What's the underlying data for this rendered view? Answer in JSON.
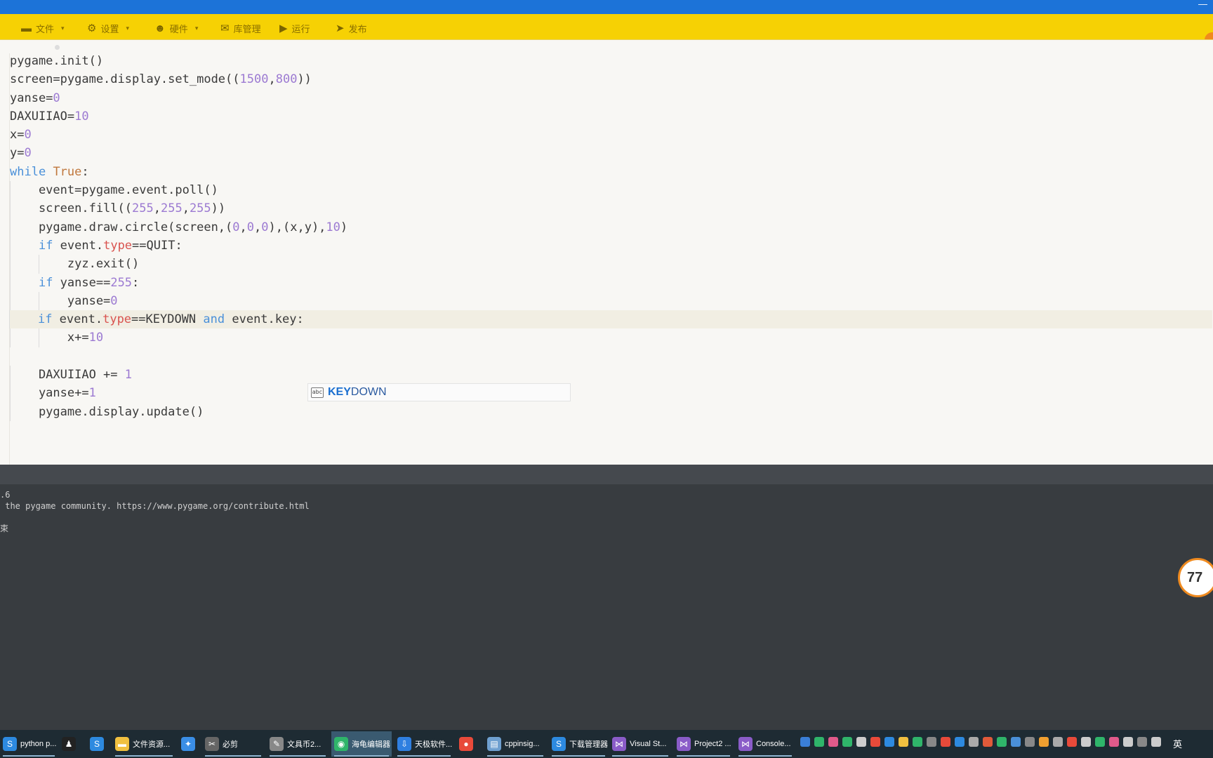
{
  "menu": [
    {
      "label": "文件",
      "icon": "folder-icon",
      "caret": true
    },
    {
      "label": "设置",
      "icon": "gear-icon",
      "caret": true
    },
    {
      "label": "硬件",
      "icon": "robot-icon",
      "caret": true
    },
    {
      "label": "库管理",
      "icon": "mail-icon",
      "caret": false
    },
    {
      "label": "运行",
      "icon": "play-icon",
      "caret": false
    },
    {
      "label": "发布",
      "icon": "send-icon",
      "caret": false
    }
  ],
  "code_lines": [
    "pygame.init()",
    "screen=pygame.display.set_mode((1500,800))",
    "yanse=0",
    "DAXUIIAO=10",
    "x=0",
    "y=0",
    "while True:",
    "    event=pygame.event.poll()",
    "    screen.fill((255,255,255))",
    "    pygame.draw.circle(screen,(0,0,0),(x,y),10)",
    "    if event.type==QUIT:",
    "        zyz.exit()",
    "    if yanse==255:",
    "        yanse=0",
    "    if event.type==KEYDOWN and event.key:",
    "        x+=10",
    "",
    "    DAXUIIAO += 1",
    "    yanse+=1",
    "    pygame.display.update()"
  ],
  "autocomplete": {
    "icon": "abc",
    "match": "KEY",
    "rest": "DOWN"
  },
  "console_lines": [
    ".6",
    " the pygame community. https://www.pygame.org/contribute.html",
    "束"
  ],
  "badge_value": "77",
  "taskbar": [
    {
      "label": "python p...",
      "icon": "sogou-icon",
      "color": "#2d8ae0"
    },
    {
      "label": "",
      "icon": "qq-icon",
      "color": "#222"
    },
    {
      "label": "",
      "icon": "sogou-icon",
      "color": "#2d8ae0"
    },
    {
      "label": "文件资源...",
      "icon": "folder-icon",
      "color": "#f0c040"
    },
    {
      "label": "",
      "icon": "bird-icon",
      "color": "#3a8ee6"
    },
    {
      "label": "必剪",
      "icon": "bijian-icon",
      "color": "#666"
    },
    {
      "label": "文具币2...",
      "icon": "pen-icon",
      "color": "#888"
    },
    {
      "label": "海龟编辑器",
      "icon": "turtle-icon",
      "color": "#2fb56a"
    },
    {
      "label": "天极软件...",
      "icon": "download-icon",
      "color": "#2f7fe0"
    },
    {
      "label": "",
      "icon": "chrome-icon",
      "color": "#e84a3a"
    },
    {
      "label": "cppinsig...",
      "icon": "doc-icon",
      "color": "#6fa0d0"
    },
    {
      "label": "下载管理器",
      "icon": "sogou-icon",
      "color": "#2d8ae0"
    },
    {
      "label": "Visual St...",
      "icon": "vs-icon",
      "color": "#8a5cc8"
    },
    {
      "label": "Project2 ...",
      "icon": "vs-icon",
      "color": "#8a5cc8"
    },
    {
      "label": "Console...",
      "icon": "vs-icon",
      "color": "#8a5cc8"
    }
  ],
  "ime": "英"
}
